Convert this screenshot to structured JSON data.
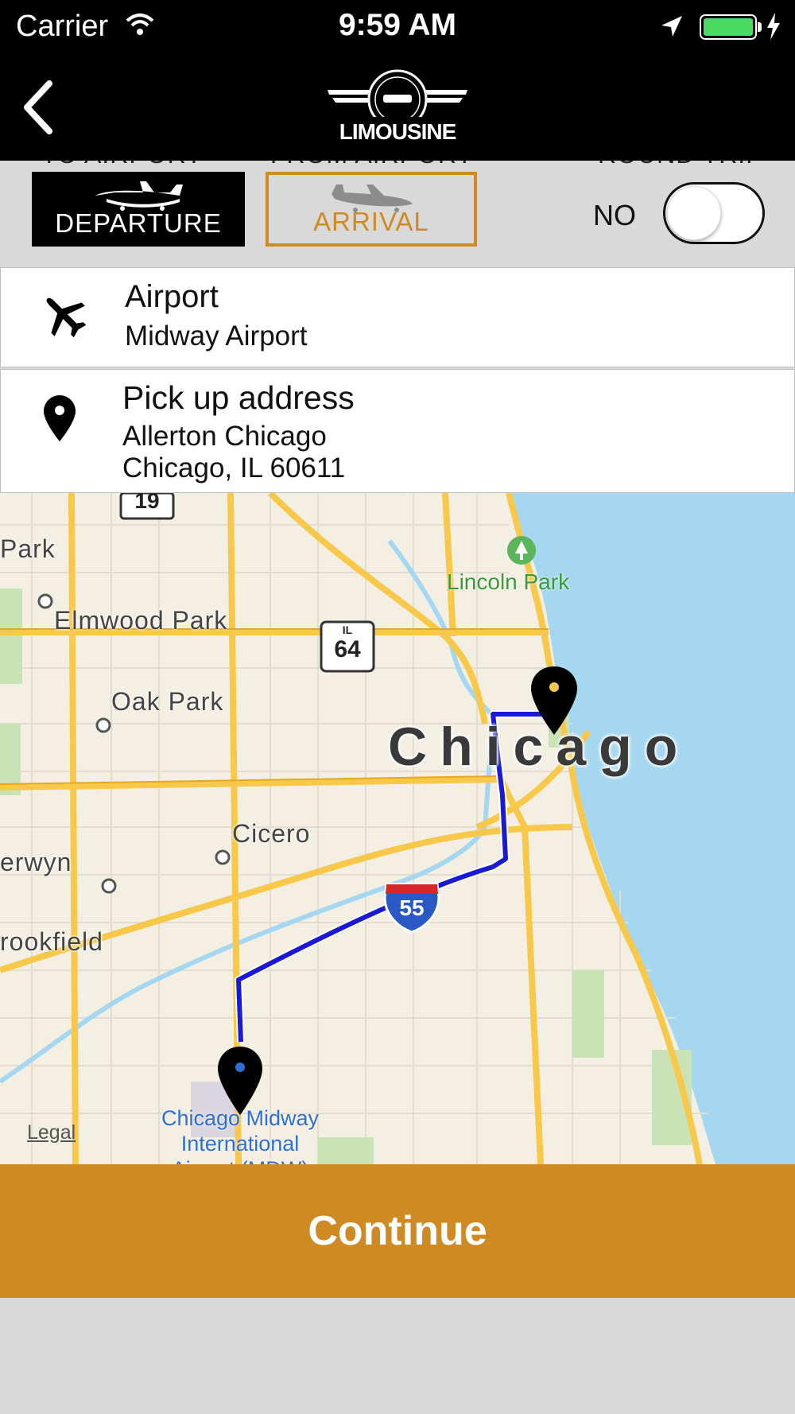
{
  "status_bar": {
    "carrier": "Carrier",
    "time": "9:59 AM",
    "battery_level": 1.0
  },
  "header": {
    "logo_text": "LIMOUSINE",
    "back_icon": "chevron-left-icon"
  },
  "trip_type": {
    "departure_caption": "TO AIRPORT",
    "arrival_caption": "FROM AIRPORT",
    "round_trip_caption": "ROUND TRIP",
    "departure_label": "DEPARTURE",
    "arrival_label": "ARRIVAL",
    "selected": "DEPARTURE",
    "round_trip_value": "NO",
    "round_trip_enabled": false
  },
  "airport_card": {
    "icon": "airplane-icon",
    "label": "Airport",
    "value": "Midway Airport"
  },
  "pickup_card": {
    "icon": "map-pin-icon",
    "label": "Pick up address",
    "line1": "Allerton Chicago",
    "line2": "Chicago, IL 60611"
  },
  "map": {
    "city": "Chicago",
    "places": [
      "Park",
      "Elmwood Park",
      "Oak Park",
      "Cicero",
      "erwyn",
      "rookfield"
    ],
    "park": "Lincoln Park",
    "airport_line1": "Chicago Midway",
    "airport_line2": "International",
    "airport_line3": "Airport (MDW)",
    "shield_il": "IL",
    "shield_il_num": "64",
    "shield_top": "19",
    "shield_interstate": "55",
    "legal": "Legal"
  },
  "colors": {
    "accent": "#cf8a24",
    "route": "#1a1ad6",
    "water": "#a5d8f0"
  },
  "continue_label": "Continue"
}
